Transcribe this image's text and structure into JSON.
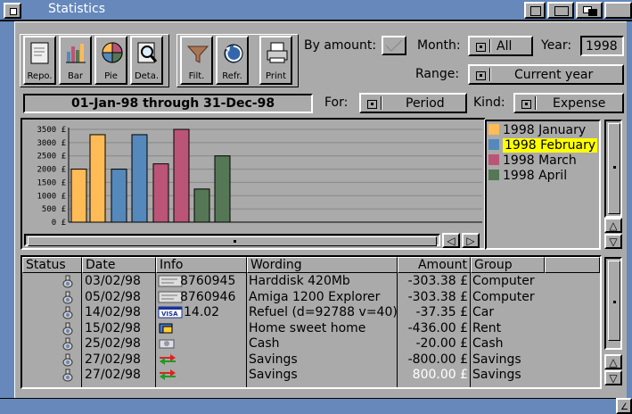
{
  "window": {
    "title": "Statistics"
  },
  "toolbar": {
    "report": "Repo.",
    "bar": "Bar",
    "pie": "Pie",
    "details": "Deta.",
    "filter": "Filt.",
    "refresh": "Refr.",
    "print": "Print"
  },
  "controls": {
    "by_amount_label": "By amount:",
    "month_label": "Month:",
    "month_value": "All",
    "year_label": "Year:",
    "year_value": "1998",
    "range_label": "Range:",
    "range_value": "Current year",
    "date_range": "01-Jan-98 through 31-Dec-98",
    "for_label": "For:",
    "for_value": "Period",
    "kind_label": "Kind:",
    "kind_value": "Expense"
  },
  "chart_data": {
    "type": "bar",
    "y_ticks": [
      "3500 £",
      "3000 £",
      "2500 £",
      "2000 £",
      "1500 £",
      "1000 £",
      "500 £",
      "0 £"
    ],
    "ylim": [
      0,
      3500
    ],
    "grid": true,
    "legend_position": "right",
    "series": [
      {
        "name": "1998 January",
        "color": "#ffbb55",
        "values": [
          2000,
          3300
        ]
      },
      {
        "name": "1998 February",
        "color": "#5588bb",
        "values": [
          2000,
          3300
        ]
      },
      {
        "name": "1998 March",
        "color": "#bb5577",
        "values": [
          2200,
          3500
        ]
      },
      {
        "name": "1998 April",
        "color": "#557755",
        "values": [
          1250,
          2500
        ]
      }
    ],
    "selected_legend": "1998 February"
  },
  "table": {
    "headers": [
      "Status",
      "Date",
      "Info",
      "Wording",
      "Amount",
      "Group"
    ],
    "rows": [
      {
        "date": "03/02/98",
        "info": "8760945",
        "info_icon": "cheque-icon",
        "wording": "Harddisk 420Mb",
        "amount": "-303.38 £",
        "group": "Computer"
      },
      {
        "date": "05/02/98",
        "info": "8760946",
        "info_icon": "cheque-icon",
        "wording": "Amiga 1200 Explorer",
        "amount": "-303.38 £",
        "group": "Computer"
      },
      {
        "date": "14/02/98",
        "info": "14.02",
        "info_icon": "visa-card-icon",
        "wording": "Refuel (d=92788 v=40)",
        "amount": "-37.35 £",
        "group": "Car"
      },
      {
        "date": "15/02/98",
        "info": "",
        "info_icon": "transfer-icon",
        "wording": "Home sweet home",
        "amount": "-436.00 £",
        "group": "Rent"
      },
      {
        "date": "25/02/98",
        "info": "",
        "info_icon": "cash-icon",
        "wording": "Cash",
        "amount": "-20.00 £",
        "group": "Cash"
      },
      {
        "date": "27/02/98",
        "info": "",
        "info_icon": "exchange-arrows-icon",
        "wording": "Savings",
        "amount": "-800.00 £",
        "group": "Savings"
      },
      {
        "date": "27/02/98",
        "info": "",
        "info_icon": "exchange-arrows-icon",
        "wording": "Savings",
        "amount": "800.00 £",
        "group": "Savings"
      }
    ]
  }
}
